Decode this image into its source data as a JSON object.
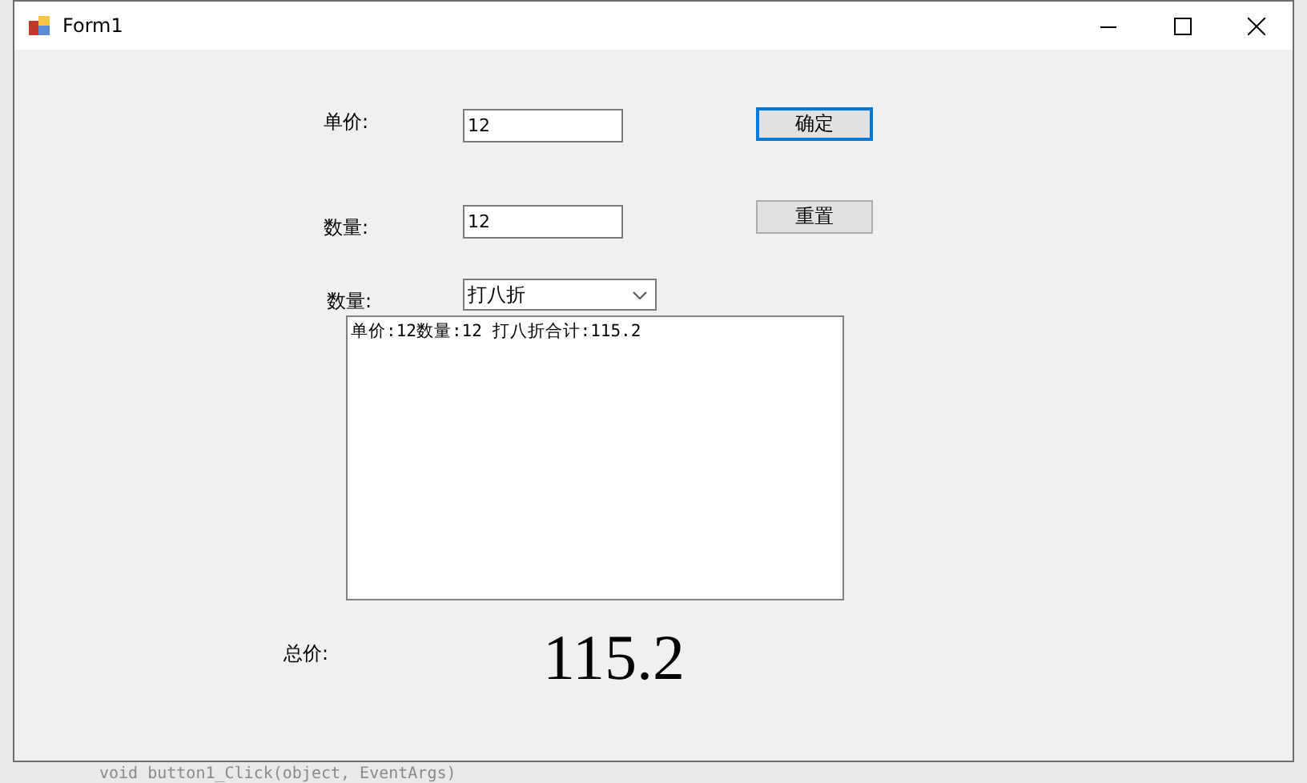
{
  "window": {
    "title": "Form1"
  },
  "fields": [
    {
      "label": "单价:",
      "value": "12"
    },
    {
      "label": "数量:",
      "value": "12"
    }
  ],
  "buttons": [
    {
      "label": "确定",
      "focused": true
    },
    {
      "label": "重置",
      "focused": false
    }
  ],
  "discount": {
    "label": "数量:",
    "value": "打八折"
  },
  "log": {
    "lines": [
      "单价:12数量:12 打八折合计:115.2"
    ]
  },
  "total": {
    "label": "总价:",
    "value": "115.2"
  },
  "background_code": {
    "text": "void button1_Click(object, EventArgs)"
  }
}
